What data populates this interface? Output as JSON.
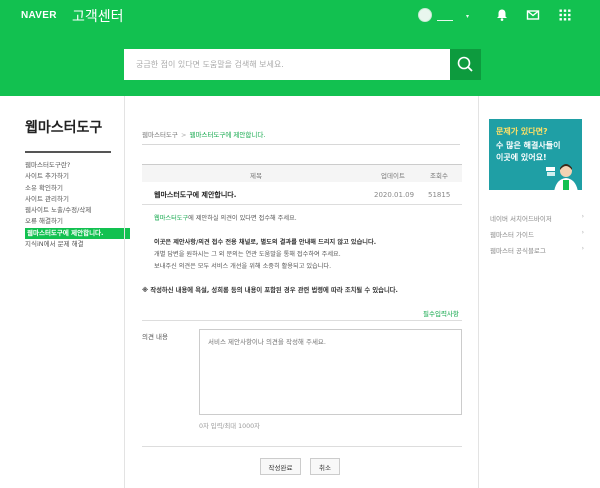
{
  "header": {
    "logo": "NAVER",
    "service_title": "고객센터",
    "user_name": "",
    "icons": [
      "bell-icon",
      "mail-icon",
      "apps-grid-icon"
    ]
  },
  "search": {
    "placeholder": "궁금한 점이 있다면 도움말을 검색해 보세요."
  },
  "sidebar": {
    "title": "웹마스터도구",
    "items": [
      {
        "label": "웹마스터도구란?"
      },
      {
        "label": "사이트 추가하기"
      },
      {
        "label": "소유 확인하기"
      },
      {
        "label": "사이트 관리하기"
      },
      {
        "label": "웹사이트 노출/수정/삭제"
      },
      {
        "label": "오류 해결하기"
      },
      {
        "label": "웹마스터도구에 제안합니다.",
        "active": true
      },
      {
        "label": "지식iN에서 문제 해결"
      }
    ]
  },
  "breadcrumb": {
    "root": "웹마스터도구",
    "separator": ">",
    "current": "웹마스터도구에 제안합니다."
  },
  "table": {
    "headers": {
      "title": "제목",
      "updated": "업데이트",
      "views": "조회수"
    },
    "row": {
      "title": "웹마스터도구에 제안합니다.",
      "updated": "2020.01.09",
      "views": "51815"
    }
  },
  "content": {
    "lead_highlight": "웹마스터도구",
    "lead_rest": "에 제안하실 의견이 있다면 접수해 주세요.",
    "bold_line": "이곳은 제안사항/의견 접수 전용 채널로, 별도의 결과를 안내해 드리지 않고 있습니다.",
    "line2": "개별 답변을 원하시는 그 외 문의는 연관 도움말을 통해 접수하여 주세요.",
    "line3": "보내주신 의견은 모두 서비스 개선을 위해 소중히 활용되고 있습니다.",
    "notice": "※ 작성하신 내용에 욕설, 성희롱 등의 내용이 포함된 경우 관련 법령에 따라 조치될 수 있습니다.",
    "required_label": "필수입력사항"
  },
  "form": {
    "label": "의견 내용",
    "placeholder": "서비스 제안사항이나 의견을 작성해 주세요.",
    "char_count": "0자 입력/최대 1000자",
    "submit_label": "작성완료",
    "cancel_label": "취소"
  },
  "banner": {
    "question": "문제가 있다면?",
    "line1": "수 많은 해결사들이",
    "line2": "이곳에 있어요!"
  },
  "related_links": [
    {
      "label": "네이버 서치어드바이저",
      "arrow": "›"
    },
    {
      "label": "웹마스터 가이드",
      "arrow": "›"
    },
    {
      "label": "웹마스터 공식블로그",
      "arrow": "›"
    }
  ],
  "colors": {
    "brand": "#12c150",
    "accent_dark": "#0d9b3e",
    "banner": "#1f9fa5"
  }
}
